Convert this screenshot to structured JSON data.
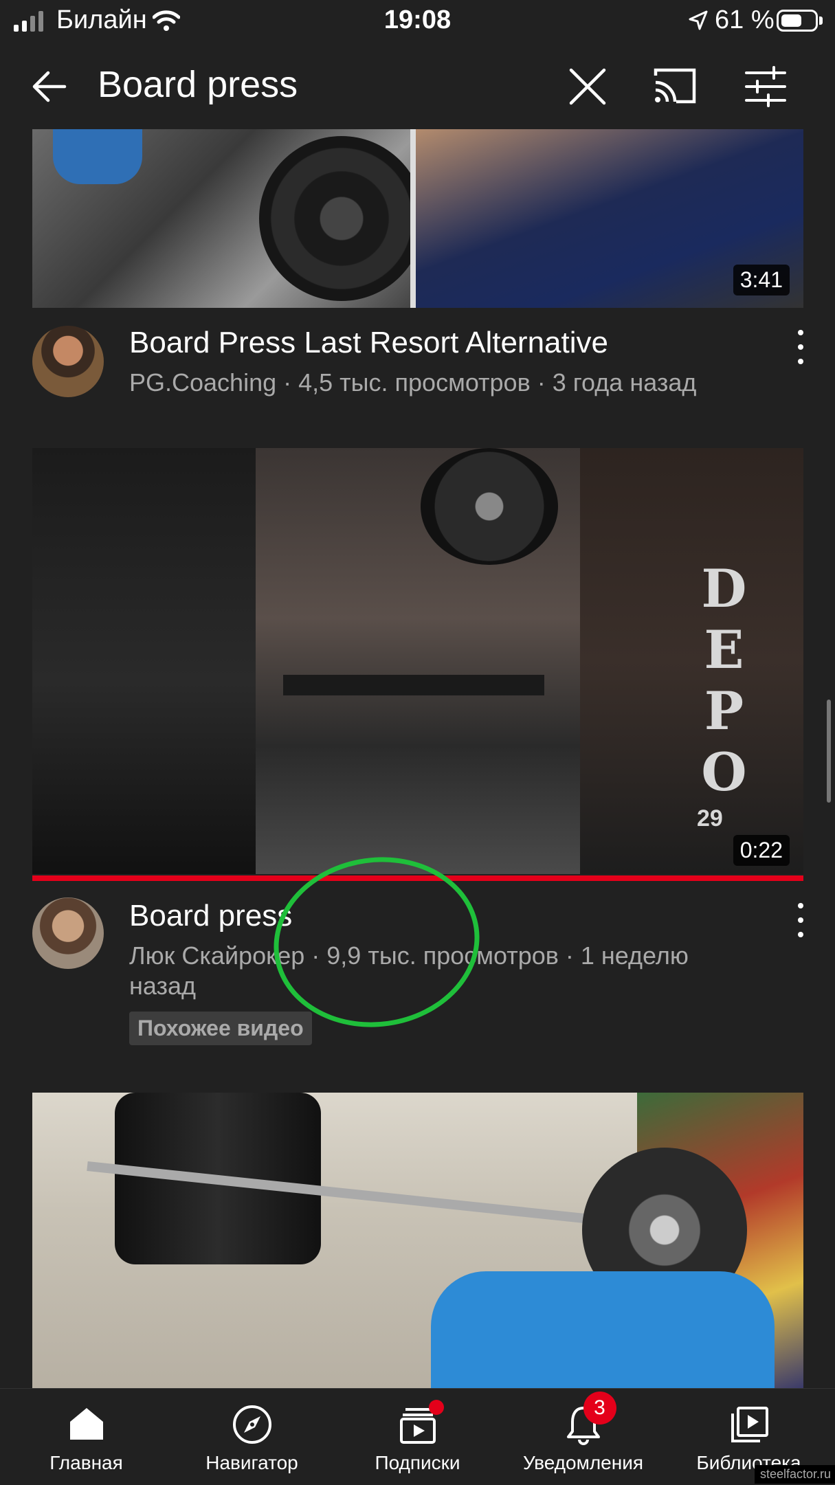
{
  "status_bar": {
    "carrier": "Билайн",
    "time": "19:08",
    "battery": "61 %",
    "battery_level": 0.61
  },
  "top_bar": {
    "query": "Board press",
    "icons": [
      "back-arrow-icon",
      "close-icon",
      "cast-icon",
      "filter-icon"
    ]
  },
  "videos": [
    {
      "duration": "3:41",
      "title": "Board Press Last Resort Alternative",
      "meta": "PG.Coaching · 4,5 тыс. просмотров · 3 года назад"
    },
    {
      "duration": "0:22",
      "title": "Board press",
      "meta_line1": "Люк Скайрокер · 9,9 тыс. просмотров · 1 неделю",
      "meta_line2": "назад",
      "tag": "Похожее видео",
      "watch_progress": 1.0,
      "thumbnail_text": "DEPO",
      "thumbnail_text_2": "29"
    },
    {
      "duration": ""
    }
  ],
  "annotation": {
    "color": "#1fbf3a"
  },
  "bottom_nav": {
    "items": [
      {
        "label": "Главная",
        "icon": "home-icon"
      },
      {
        "label": "Навигатор",
        "icon": "compass-icon"
      },
      {
        "label": "Подписки",
        "icon": "subscriptions-icon"
      },
      {
        "label": "Уведомления",
        "icon": "bell-icon",
        "badge": "3"
      },
      {
        "label": "Библиотека",
        "icon": "library-icon"
      }
    ]
  },
  "watermark": "steelfactor.ru",
  "colors": {
    "background": "#212121",
    "accent_red": "#e4001a",
    "meta_grey": "#aaaaaa"
  }
}
